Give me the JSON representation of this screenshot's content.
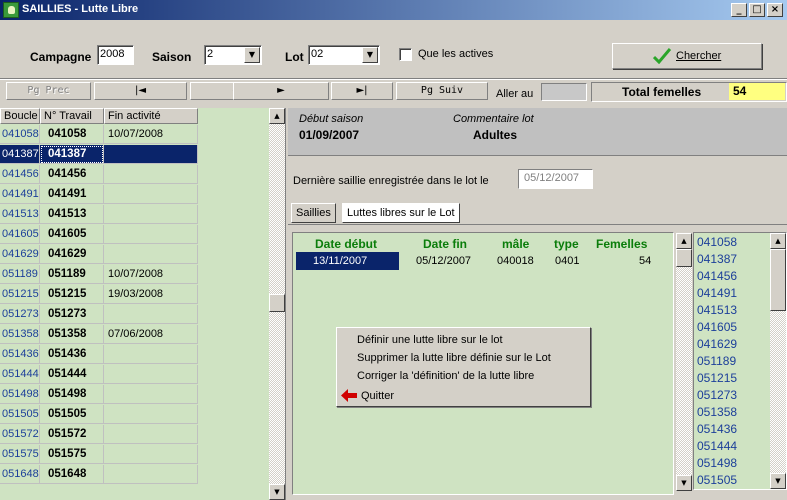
{
  "window": {
    "title": "SAILLIES - Lutte Libre",
    "icon": "sheep-app-icon",
    "controls": [
      "_",
      "□",
      "×"
    ]
  },
  "filters": {
    "campagne_label": "Campagne",
    "campagne_value": "2008",
    "saison_label": "Saison",
    "saison_value": "2",
    "lot_label": "Lot",
    "lot_value": "02",
    "active_only_label": "Que les actives",
    "active_only_checked": false,
    "search_button": "Chercher",
    "search_accel": "C"
  },
  "nav": {
    "prev_page": "Pg Prec",
    "first": "|◄",
    "prev": "◄",
    "next": "►",
    "last": "►|",
    "next_page": "Pg Suiv",
    "goto_label": "Aller au",
    "goto_value": "",
    "total_label": "Total femelles",
    "total_value": "54"
  },
  "grid": {
    "columns": [
      "Boucle",
      "N° Travail",
      "Fin activité"
    ],
    "rows": [
      {
        "boucle": "041058",
        "travail": "041058",
        "fin": "10/07/2008"
      },
      {
        "boucle": "041387",
        "travail": "041387",
        "fin": ""
      },
      {
        "boucle": "041456",
        "travail": "041456",
        "fin": ""
      },
      {
        "boucle": "041491",
        "travail": "041491",
        "fin": ""
      },
      {
        "boucle": "041513",
        "travail": "041513",
        "fin": ""
      },
      {
        "boucle": "041605",
        "travail": "041605",
        "fin": ""
      },
      {
        "boucle": "041629",
        "travail": "041629",
        "fin": ""
      },
      {
        "boucle": "051189",
        "travail": "051189",
        "fin": "10/07/2008"
      },
      {
        "boucle": "051215",
        "travail": "051215",
        "fin": "19/03/2008"
      },
      {
        "boucle": "051273",
        "travail": "051273",
        "fin": ""
      },
      {
        "boucle": "051358",
        "travail": "051358",
        "fin": "07/06/2008"
      },
      {
        "boucle": "051436",
        "travail": "051436",
        "fin": ""
      },
      {
        "boucle": "051444",
        "travail": "051444",
        "fin": ""
      },
      {
        "boucle": "051498",
        "travail": "051498",
        "fin": ""
      },
      {
        "boucle": "051505",
        "travail": "051505",
        "fin": ""
      },
      {
        "boucle": "051572",
        "travail": "051572",
        "fin": ""
      },
      {
        "boucle": "051575",
        "travail": "051575",
        "fin": ""
      },
      {
        "boucle": "051648",
        "travail": "051648",
        "fin": ""
      }
    ],
    "selected_index": 1
  },
  "info": {
    "debut_saison_label": "Début saison",
    "debut_saison_value": "01/09/2007",
    "commentaire_label": "Commentaire lot",
    "commentaire_value": "Adultes",
    "derniere_label": "Dernière saillie enregistrée dans le lot le",
    "derniere_value": "05/12/2007"
  },
  "tabs": [
    "Saillies",
    "Luttes libres sur le Lot"
  ],
  "active_tab": 1,
  "luttes": {
    "headers": [
      "Date début",
      "Date fin",
      "mâle",
      "type",
      "Femelles"
    ],
    "rows": [
      {
        "debut": "13/11/2007",
        "fin": "05/12/2007",
        "male": "040018",
        "type": "0401",
        "femelles": "54"
      }
    ]
  },
  "context_menu": {
    "items": [
      "Définir une lutte libre sur le lot",
      "Supprimer la lutte libre définie sur le Lot",
      "Corriger la 'définition' de la lutte libre",
      "Quitter"
    ],
    "quit_icon": "red-left-arrow-icon"
  },
  "female_list": [
    "041058",
    "041387",
    "041456",
    "041491",
    "041513",
    "041605",
    "041629",
    "051189",
    "051215",
    "051273",
    "051358",
    "051436",
    "051444",
    "051498",
    "051505"
  ],
  "colors": {
    "title_gradient_start": "#0a246a",
    "title_gradient_end": "#a6caf0",
    "grid_bg": "#cfe3c2",
    "selection": "#0a246a",
    "header_green": "#0a7d0a",
    "id_blue": "#1c3f9a",
    "total_bg": "#ffff80",
    "search_check": "#2aa52a",
    "quit_arrow": "#d00000"
  }
}
